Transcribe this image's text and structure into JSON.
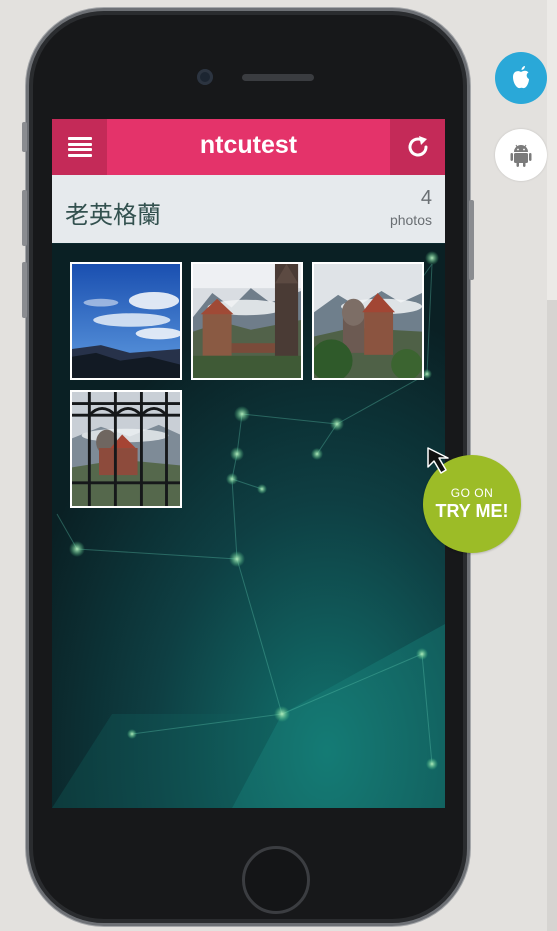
{
  "app": {
    "title": "ntcutest"
  },
  "album": {
    "name": "老英格蘭",
    "count": "4",
    "count_unit": "photos"
  },
  "photos": [
    {
      "name": "photo-1",
      "description": "blue sky with clouds over hills"
    },
    {
      "name": "photo-2",
      "description": "castle building with mountains"
    },
    {
      "name": "photo-3",
      "description": "castle tower with mountains"
    },
    {
      "name": "photo-4",
      "description": "view through iron gate"
    }
  ],
  "promo": {
    "small_label": "GO ON",
    "big_label": "TRY ME!"
  },
  "platforms": {
    "ios_icon": "apple-icon",
    "android_icon": "android-icon"
  },
  "colors": {
    "appbar": "#e4336a",
    "appbar_button": "#c42a58",
    "album_bar": "#e6eaed",
    "tryme": "#9cbc27",
    "ios_button": "#2aa8d8"
  }
}
